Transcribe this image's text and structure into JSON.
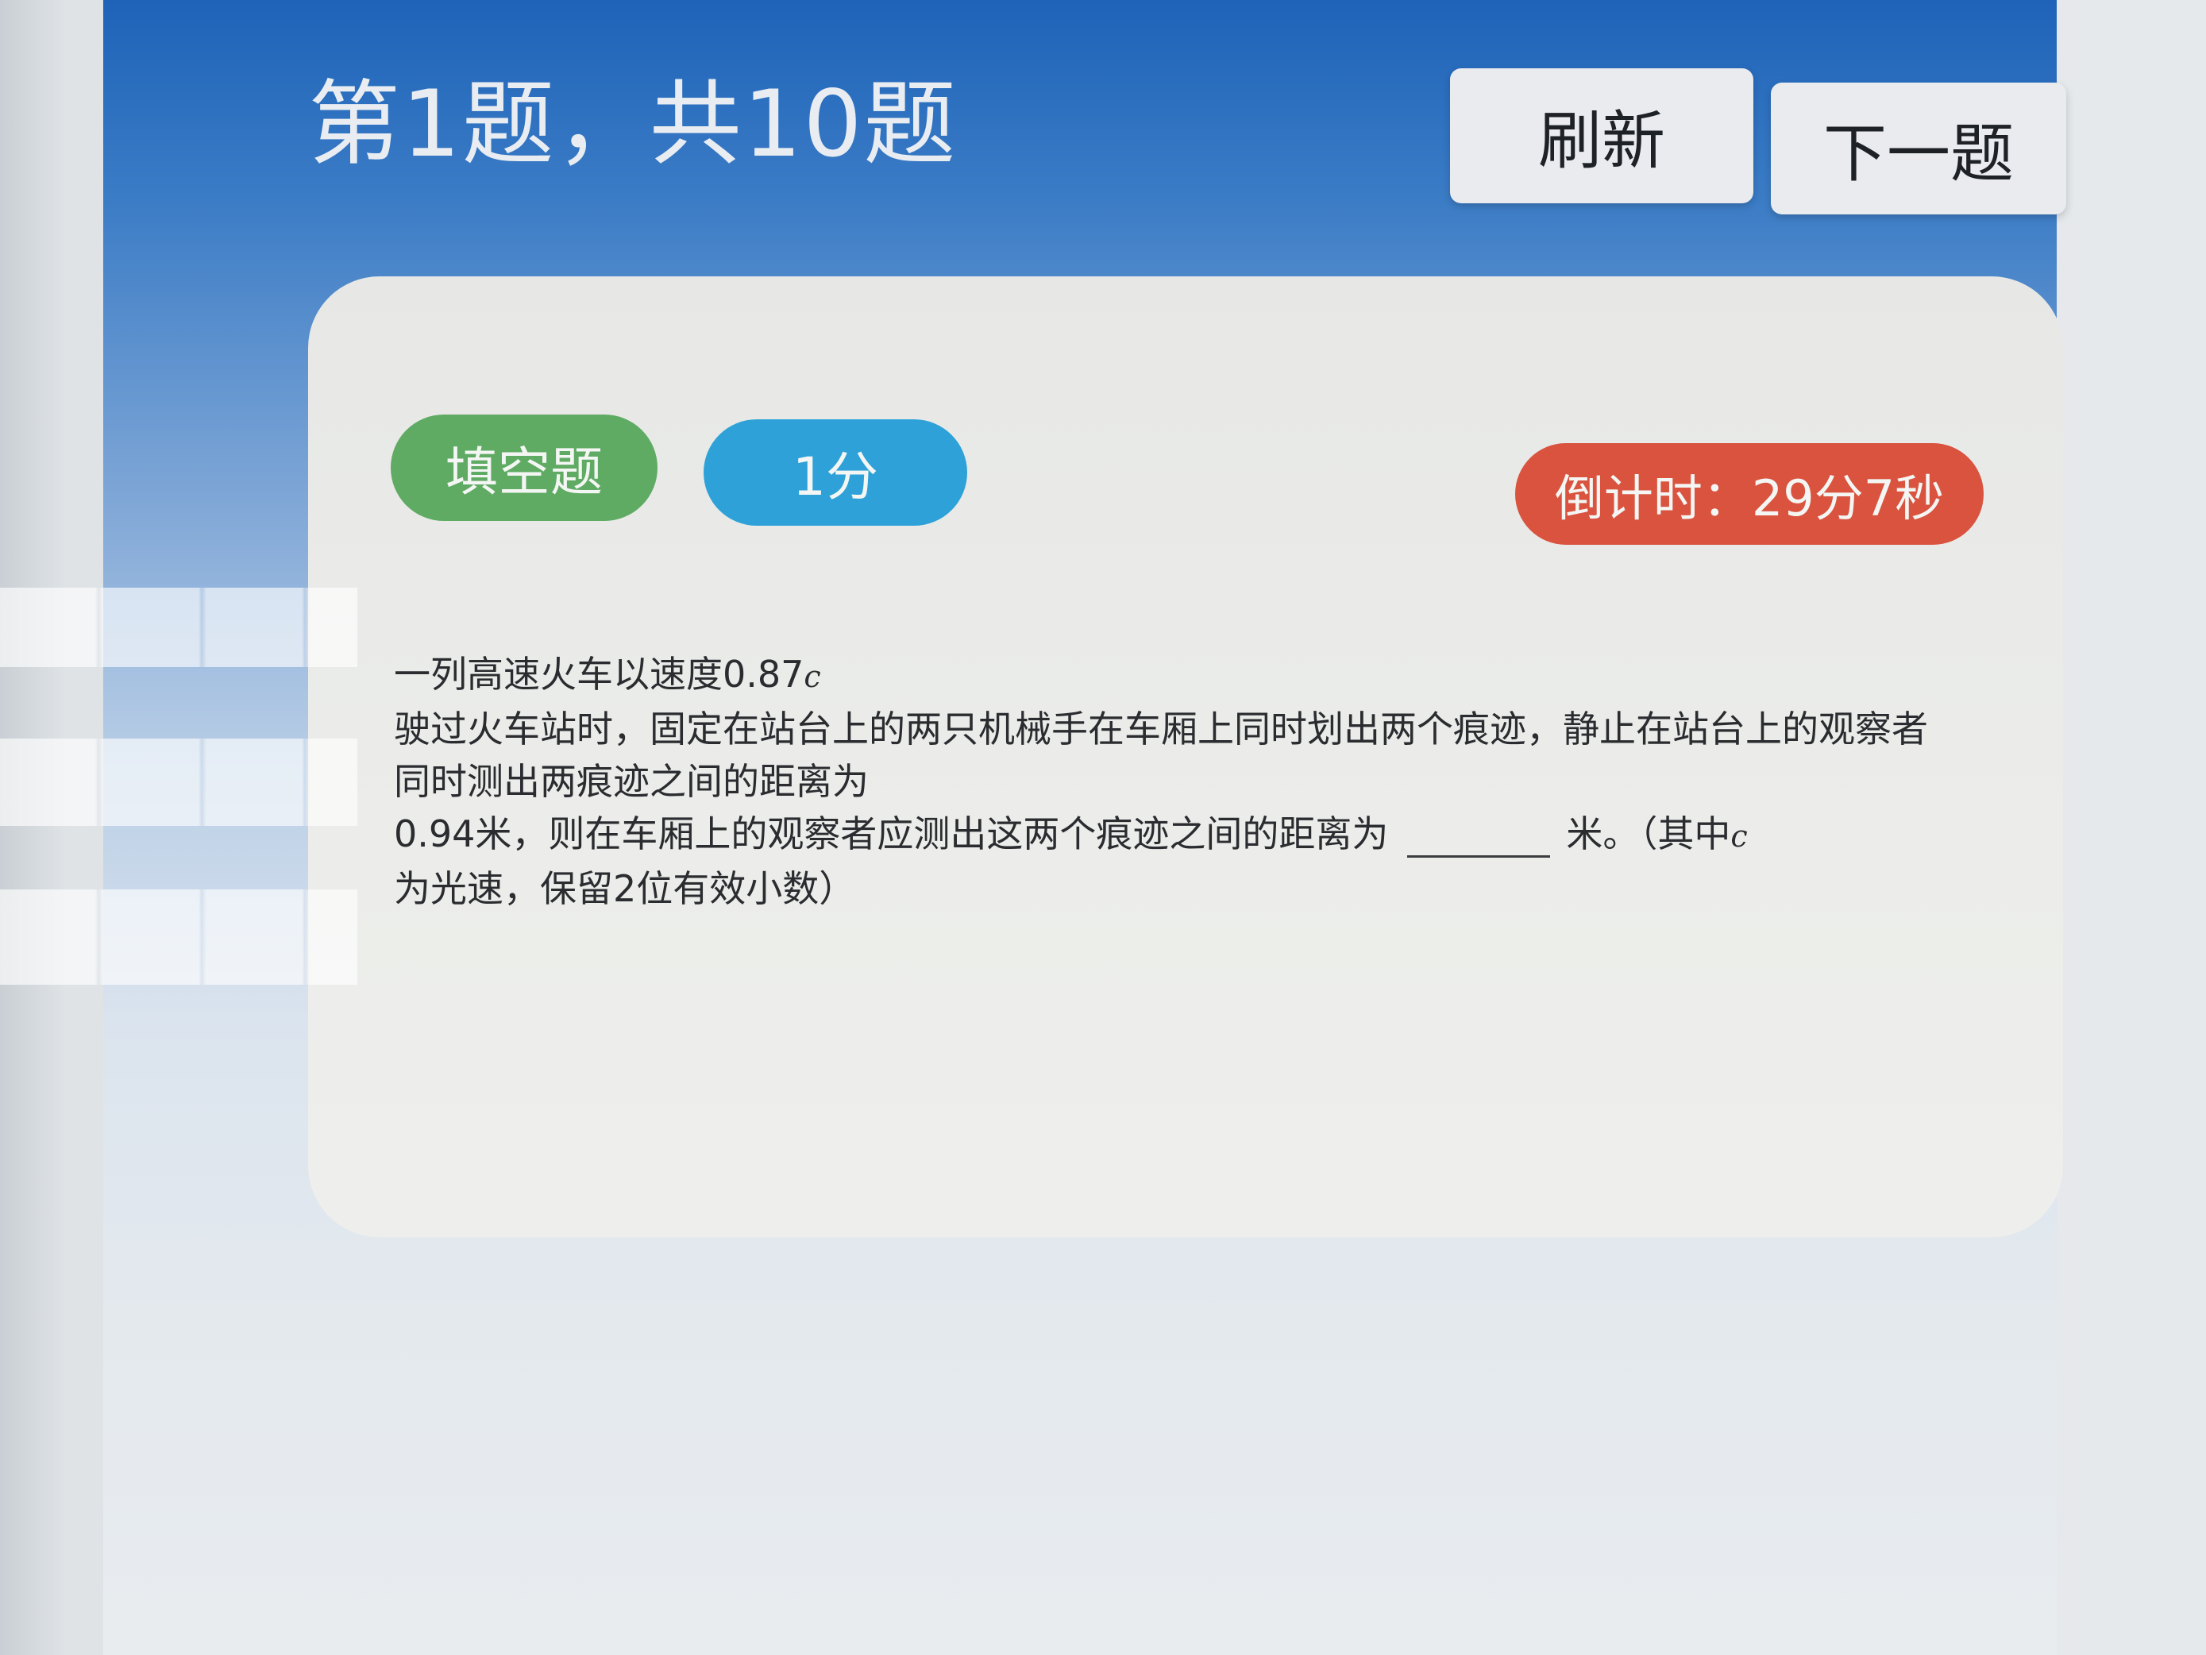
{
  "header": {
    "title": "第1题，共10题",
    "refresh_label": "刷新",
    "next_label": "下一题"
  },
  "question_card": {
    "type_tag": "填空题",
    "score_tag": "1分",
    "timer": "倒计时：29分7秒",
    "text": {
      "line1_prefix": "一列高速火车以速度0.87",
      "line1_var": "c",
      "line2": "驶过火车站时，固定在站台上的两只机械手在车厢上同时划出两个痕迹，静止在站台上的观察者",
      "line3": "同时测出两痕迹之间的距离为",
      "line4_prefix": "0.94米，则在车厢上的观察者应测出这两个痕迹之间的距离为",
      "line4_suffix": "米。（其中",
      "line4_var": "c",
      "line5": "为光速，保留2位有效小数）",
      "answer_value": ""
    }
  },
  "colors": {
    "header_blue": "#1e63b8",
    "tag_green": "#5fab63",
    "tag_blue": "#2ea2d8",
    "tag_red": "#d9533f"
  }
}
